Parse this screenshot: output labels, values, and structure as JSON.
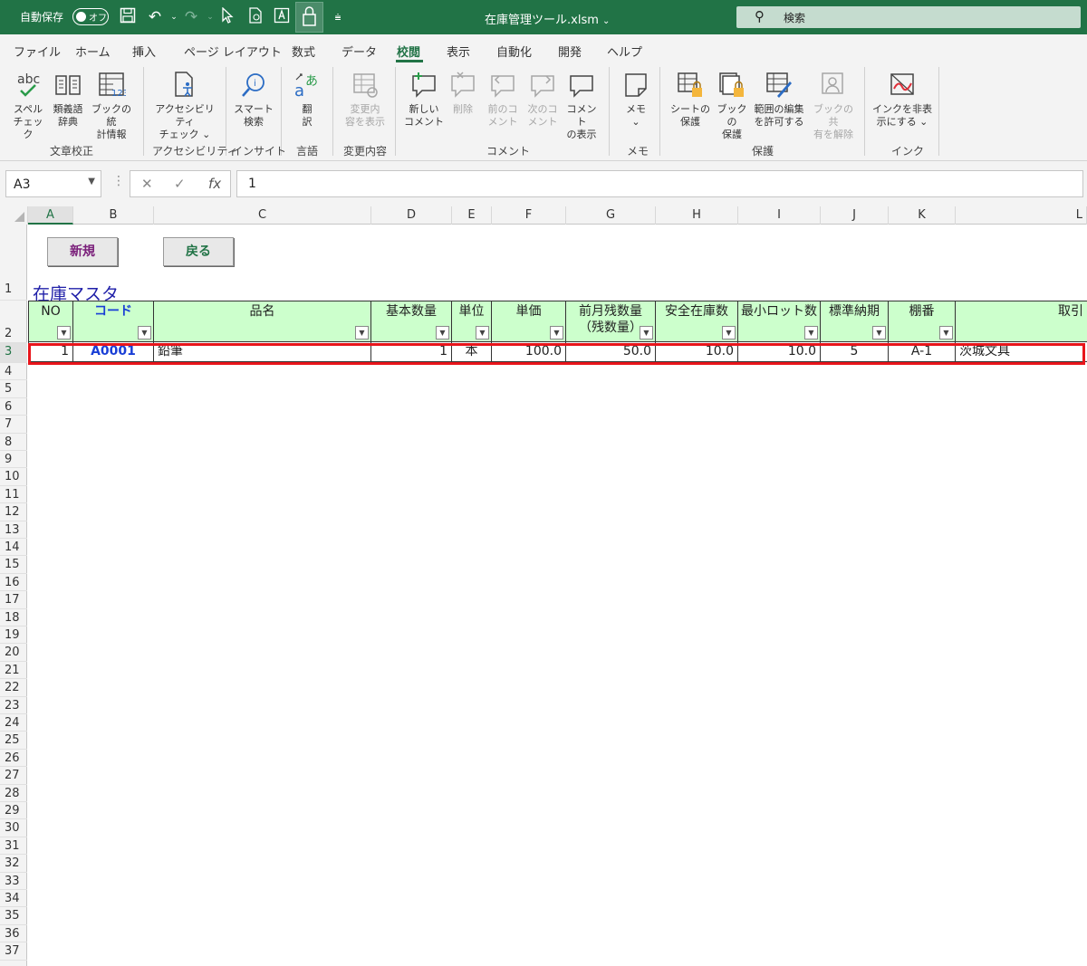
{
  "titlebar": {
    "autosave_label": "自動保存",
    "autosave_state": "オフ",
    "filename": "在庫管理ツール.xlsm",
    "search_label": "検索"
  },
  "menu": {
    "tabs": [
      "ファイル",
      "ホーム",
      "挿入",
      "ページ レイアウト",
      "数式",
      "データ",
      "校閲",
      "表示",
      "自動化",
      "開発",
      "ヘルプ"
    ],
    "active_tab": "校閲"
  },
  "ribbon": {
    "buttons": {
      "spell": [
        "スペル",
        "チェック"
      ],
      "thesaurus": [
        "類義語",
        "辞典"
      ],
      "workbook_stats": [
        "ブックの統",
        "計情報"
      ],
      "accessibility": [
        "アクセシビリティ",
        "チェック ⌄"
      ],
      "smart_lookup": [
        "スマート",
        "検索"
      ],
      "translate": [
        "翻",
        "訳"
      ],
      "show_changes": [
        "変更内",
        "容を表示"
      ],
      "new_comment": [
        "新しい",
        "コメント"
      ],
      "delete": [
        "削除",
        ""
      ],
      "prev_comment": [
        "前のコ",
        "メント"
      ],
      "next_comment": [
        "次のコ",
        "メント"
      ],
      "show_comments": [
        "コメント",
        "の表示"
      ],
      "notes": [
        "メモ",
        "⌄"
      ],
      "protect_sheet": [
        "シートの",
        "保護"
      ],
      "protect_workbook": [
        "ブックの",
        "保護"
      ],
      "allow_edit": [
        "範囲の編集",
        "を許可する"
      ],
      "unshare": [
        "ブックの共",
        "有を解除"
      ],
      "hide_ink": [
        "インクを非表",
        "示にする ⌄"
      ]
    },
    "groups": {
      "proofing": "文章校正",
      "accessibility": "アクセシビリティ",
      "insights": "インサイト",
      "language": "言語",
      "changes": "変更内容",
      "comments": "コメント",
      "notes": "メモ",
      "protect": "保護",
      "ink": "インク"
    }
  },
  "formula_bar": {
    "name_box": "A3",
    "cancel_icon": "✕",
    "enter_icon": "✓",
    "fx": "fx",
    "value": "1"
  },
  "columns": [
    "A",
    "B",
    "C",
    "D",
    "E",
    "F",
    "G",
    "H",
    "I",
    "J",
    "K",
    "L"
  ],
  "rows": [
    "1",
    "2",
    "3",
    "4",
    "5",
    "6",
    "7",
    "8",
    "9",
    "10",
    "11",
    "12",
    "13",
    "14",
    "15",
    "16",
    "17",
    "18",
    "19",
    "20",
    "21",
    "22",
    "23",
    "24",
    "25",
    "26",
    "27",
    "28",
    "29",
    "30",
    "31",
    "32",
    "33",
    "34",
    "35",
    "36",
    "37"
  ],
  "sheet": {
    "new_button": "新規",
    "back_button": "戻る",
    "title": "在庫マスタ",
    "headers": {
      "no": "NO",
      "code": "コード",
      "name": "品名",
      "base_qty": "基本数量",
      "unit": "単位",
      "unit_price": "単価",
      "prev_balance_1": "前月残数量",
      "prev_balance_2": "（残数量）",
      "safety_stock": "安全在庫数",
      "min_lot": "最小ロット数",
      "lead_time": "標準納期",
      "shelf": "棚番",
      "supplier": "取引"
    },
    "row": {
      "no": "1",
      "code": "A0001",
      "name": "鉛筆",
      "base_qty": "1",
      "unit": "本",
      "unit_price": "100.0",
      "prev_balance": "50.0",
      "safety_stock": "10.0",
      "min_lot": "10.0",
      "lead_time": "5",
      "shelf": "A-1",
      "supplier": "茨城文具"
    }
  },
  "colors": {
    "excel_green": "#217346",
    "header_fill": "#ccffcc",
    "highlight": "#e8151b",
    "title_blue": "#1f1fa8",
    "new_button_text": "#7a1f7a",
    "back_button_text": "#217346"
  }
}
